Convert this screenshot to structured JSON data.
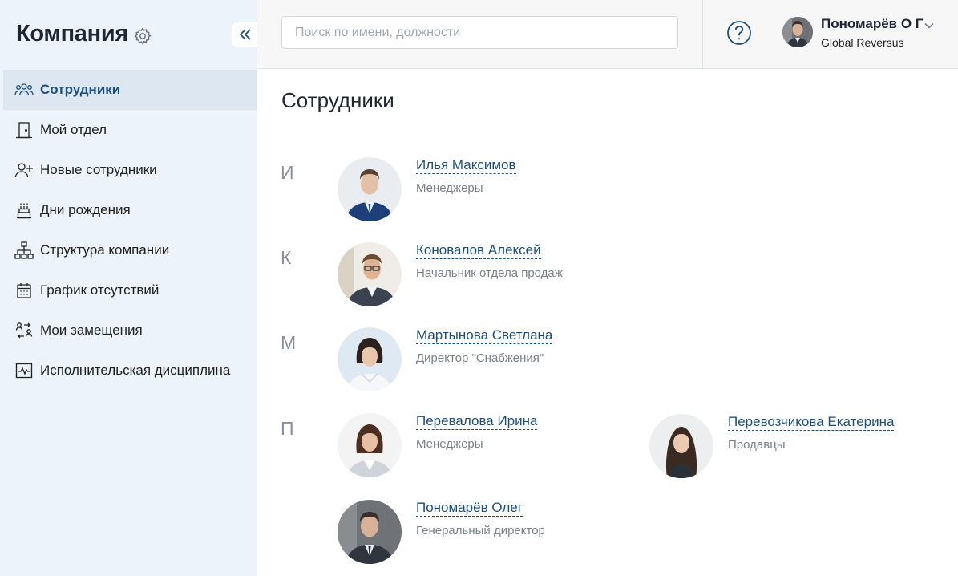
{
  "sidebar": {
    "title": "Компания",
    "items": [
      {
        "label": "Сотрудники",
        "icon": "users-icon",
        "active": true
      },
      {
        "label": "Мой отдел",
        "icon": "door-icon"
      },
      {
        "label": "Новые сотрудники",
        "icon": "user-plus-icon"
      },
      {
        "label": "Дни рождения",
        "icon": "cake-icon"
      },
      {
        "label": "Структура компании",
        "icon": "org-structure-icon"
      },
      {
        "label": "График отсутствий",
        "icon": "calendar-icon"
      },
      {
        "label": "Мои замещения",
        "icon": "substitution-icon"
      },
      {
        "label": "Исполнительская дисциплина",
        "icon": "chart-pulse-icon"
      }
    ]
  },
  "header": {
    "search_placeholder": "Поиск по имени, должности",
    "user_name": "Пономарёв О Г",
    "user_company": "Global Reversus"
  },
  "main": {
    "title": "Сотрудники",
    "groups": [
      {
        "letter": "И",
        "employees": [
          {
            "name": "Илья Максимов",
            "role": "Менеджеры"
          }
        ]
      },
      {
        "letter": "К",
        "employees": [
          {
            "name": "Коновалов Алексей",
            "role": "Начальник отдела продаж"
          }
        ]
      },
      {
        "letter": "М",
        "employees": [
          {
            "name": "Мартынова Светлана",
            "role": "Директор \"Снабжения\""
          }
        ]
      },
      {
        "letter": "П",
        "employees": [
          {
            "name": "Перевалова Ирина",
            "role": "Менеджеры"
          },
          {
            "name": "Перевозчикова Екатерина",
            "role": "Продавцы"
          },
          {
            "name": "Пономарёв Олег",
            "role": "Генеральный директор"
          }
        ]
      }
    ]
  },
  "colors": {
    "accent": "#1e4f7a",
    "sidebar_bg": "#edf3fa",
    "active_bg": "#dce7f2"
  }
}
